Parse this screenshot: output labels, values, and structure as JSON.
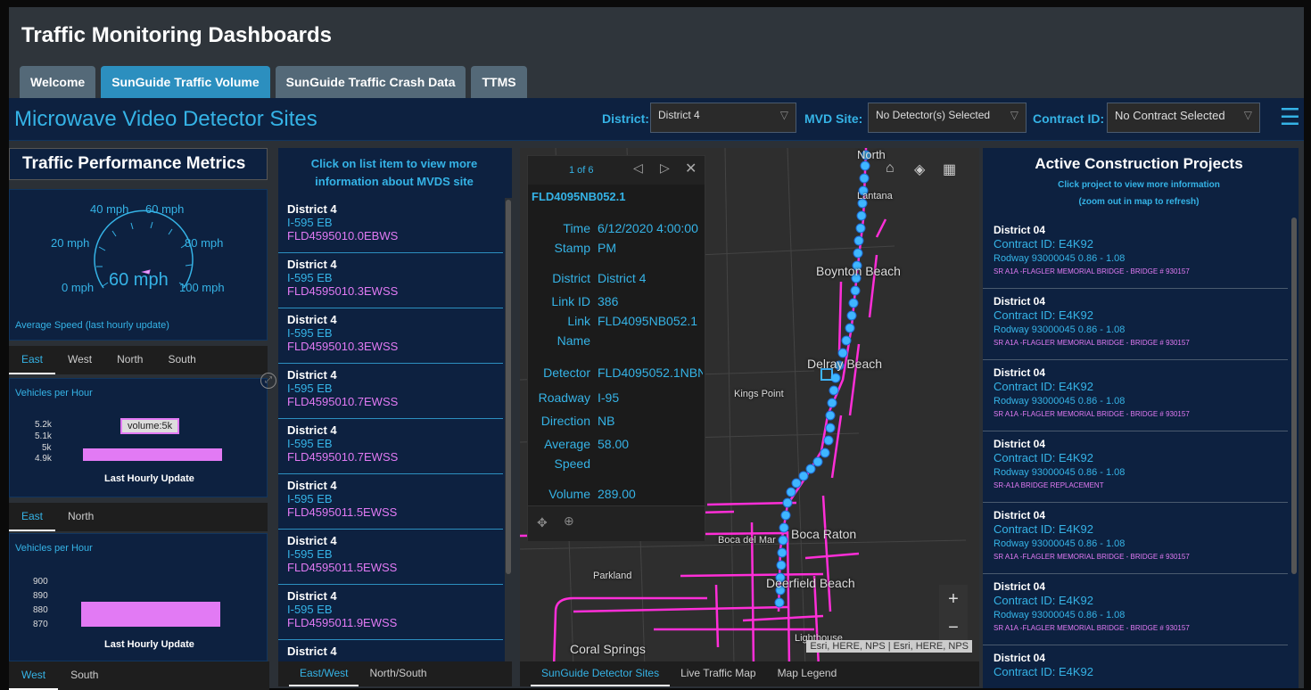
{
  "app_title": "Traffic Monitoring Dashboards",
  "tabs": [
    "Welcome",
    "SunGuide Traffic Volume",
    "SunGuide Traffic Crash Data",
    "TTMS"
  ],
  "header": {
    "title": "Microwave Video Detector Sites",
    "district_label": "District:",
    "district_value": "District 4",
    "mvd_label": "MVD Site:",
    "mvd_value": "No Detector(s) Selected",
    "contract_label": "Contract ID:",
    "contract_value": "No Contract Selected"
  },
  "metrics": {
    "title": "Traffic Performance Metrics",
    "gauge": {
      "labels": [
        "40 mph",
        "60 mph",
        "20 mph",
        "80 mph",
        "0 mph",
        "100 mph"
      ],
      "value": "60 mph",
      "value_mph": 60,
      "caption": "Average Speed (last hourly update)"
    },
    "tabs1": [
      "East",
      "West",
      "North",
      "South"
    ],
    "chart1": {
      "title": "Vehicles per Hour",
      "ticks": [
        "5.2k",
        "5.1k",
        "5k",
        "4.9k"
      ],
      "tooltip": "volume:5k",
      "xlabel": "Last Hourly Update"
    },
    "tabs2": [
      "East",
      "North"
    ],
    "chart2": {
      "title": "Vehicles per Hour",
      "ticks": [
        "900",
        "890",
        "880",
        "870"
      ],
      "xlabel": "Last Hourly Update"
    },
    "tabs3": [
      "West",
      "South"
    ]
  },
  "chart_data": [
    {
      "type": "bar",
      "categories": [
        "Last Hourly Update"
      ],
      "values": [
        5000
      ],
      "ylabel": "Vehicles per Hour",
      "ylim": [
        4900,
        5200
      ]
    },
    {
      "type": "bar",
      "categories": [
        "Last Hourly Update"
      ],
      "values": [
        887
      ],
      "ylabel": "Vehicles per Hour",
      "ylim": [
        870,
        900
      ]
    }
  ],
  "list": {
    "header": "Click on list item to view more information about MVDS site",
    "items": [
      {
        "district": "District 4",
        "road": "I-595 EB",
        "id": "FLD4595010.0EBWS"
      },
      {
        "district": "District 4",
        "road": "I-595 EB",
        "id": "FLD4595010.3EWSS"
      },
      {
        "district": "District 4",
        "road": "I-595 EB",
        "id": "FLD4595010.3EWSS"
      },
      {
        "district": "District 4",
        "road": "I-595 EB",
        "id": "FLD4595010.7EWSS"
      },
      {
        "district": "District 4",
        "road": "I-595 EB",
        "id": "FLD4595010.7EWSS"
      },
      {
        "district": "District 4",
        "road": "I-595 EB",
        "id": "FLD4595011.5EWSS"
      },
      {
        "district": "District 4",
        "road": "I-595 EB",
        "id": "FLD4595011.5EWSS"
      },
      {
        "district": "District 4",
        "road": "I-595 EB",
        "id": "FLD4595011.9EWSS"
      },
      {
        "district": "District 4",
        "road": "",
        "id": ""
      }
    ],
    "tabs": [
      "East/West",
      "North/South"
    ]
  },
  "map": {
    "popup_counter": "1 of 6",
    "popup_title": "FLD4095NB052.1",
    "fields": [
      {
        "k1": "Time",
        "k2": "Stamp",
        "v1": "6/12/2020 4:00:00",
        "v2": "PM"
      },
      {
        "k1": "District",
        "k2": "",
        "v1": "District 4",
        "v2": ""
      },
      {
        "k1": "Link ID",
        "k2": "",
        "v1": "386",
        "v2": ""
      },
      {
        "k1": "Link",
        "k2": "Name",
        "v1": "FLD4095NB052.1",
        "v2": ""
      },
      {
        "k1": "Detector",
        "k2": "",
        "v1": "FLD4095052.1NBN",
        "v2": ""
      },
      {
        "k1": "Roadway",
        "k2": "",
        "v1": "I-95",
        "v2": ""
      },
      {
        "k1": "Direction",
        "k2": "",
        "v1": "NB",
        "v2": ""
      },
      {
        "k1": "Average",
        "k2": "Speed",
        "v1": "58.00",
        "v2": ""
      },
      {
        "k1": "Volume",
        "k2": "",
        "v1": "289.00",
        "v2": ""
      }
    ],
    "places": [
      "North",
      "Lantana",
      "Boynton Beach",
      "Delray Beach",
      "Kings Point",
      "Boca del Mar",
      "Boca Raton",
      "Parkland",
      "Deerfield Beach",
      "Coral Springs",
      "Lighthouse"
    ],
    "attribution": "Esri, HERE, NPS | Esri, HERE, NPS",
    "tabs": [
      "SunGuide Detector Sites",
      "Live Traffic Map",
      "Map Legend"
    ]
  },
  "construction": {
    "title": "Active Construction Projects",
    "sub1": "Click project to view more information",
    "sub2": "(zoom out in map to refresh)",
    "items": [
      {
        "district": "District 04",
        "contract": "Contract ID: E4K92",
        "road": "Rodway 93000045  0.86 - 1.08",
        "desc": "SR A1A -FLAGLER MEMORIAL BRIDGE - BRIDGE # 930157"
      },
      {
        "district": "District 04",
        "contract": "Contract ID: E4K92",
        "road": "Rodway 93000045  0.86 - 1.08",
        "desc": "SR A1A -FLAGLER MEMORIAL BRIDGE - BRIDGE # 930157"
      },
      {
        "district": "District 04",
        "contract": "Contract ID: E4K92",
        "road": "Rodway 93000045  0.86 - 1.08",
        "desc": "SR A1A -FLAGLER MEMORIAL BRIDGE - BRIDGE # 930157"
      },
      {
        "district": "District 04",
        "contract": "Contract ID: E4K92",
        "road": "Rodway 93000045  0.86 - 1.08",
        "desc": "SR-A1A BRIDGE REPLACEMENT"
      },
      {
        "district": "District 04",
        "contract": "Contract ID: E4K92",
        "road": "Rodway 93000045  0.86 - 1.08",
        "desc": "SR A1A -FLAGLER MEMORIAL BRIDGE - BRIDGE # 930157"
      },
      {
        "district": "District 04",
        "contract": "Contract ID: E4K92",
        "road": "Rodway 93000045  0.86 - 1.08",
        "desc": "SR A1A -FLAGLER MEMORIAL BRIDGE - BRIDGE # 930157"
      },
      {
        "district": "District 04",
        "contract": "Contract ID: E4K92",
        "road": "",
        "desc": ""
      }
    ]
  }
}
